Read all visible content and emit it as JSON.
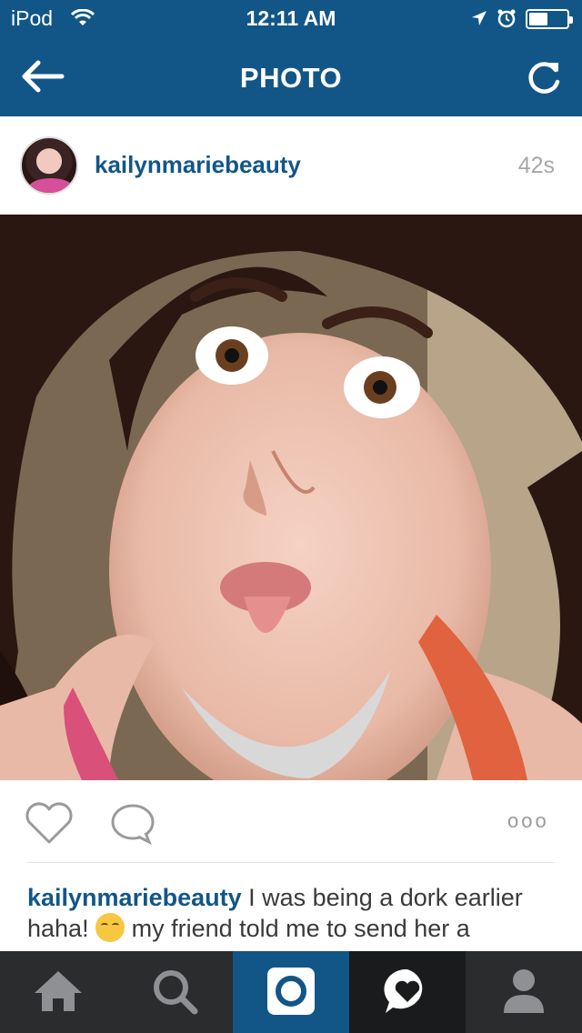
{
  "status_bar": {
    "carrier": "iPod",
    "time": "12:11 AM",
    "icons": [
      "wifi-icon",
      "location-arrow-icon",
      "alarm-icon",
      "battery-icon"
    ]
  },
  "nav": {
    "title": "PHOTO",
    "back_icon": "back-arrow-icon",
    "refresh_icon": "refresh-icon"
  },
  "post": {
    "username": "kailynmariebeauty",
    "time_ago": "42s",
    "caption_user": "kailynmariebeauty",
    "caption_text_1": " I was being a dork earlier haha! ",
    "caption_text_2": " my friend told me to send her a"
  },
  "actions": {
    "like_icon": "heart-icon",
    "comment_icon": "comment-icon",
    "more": "ooo"
  },
  "tabbar": {
    "tabs": [
      {
        "icon": "home-icon",
        "active": false
      },
      {
        "icon": "search-icon",
        "active": false
      },
      {
        "icon": "camera-icon",
        "active": true
      },
      {
        "icon": "activity-heart-icon",
        "active": false
      },
      {
        "icon": "profile-icon",
        "active": false
      }
    ]
  },
  "colors": {
    "brand_blue": "#125688",
    "tabbar_bg": "#2a2c2e",
    "timestamp_gray": "#a5a7aa"
  }
}
